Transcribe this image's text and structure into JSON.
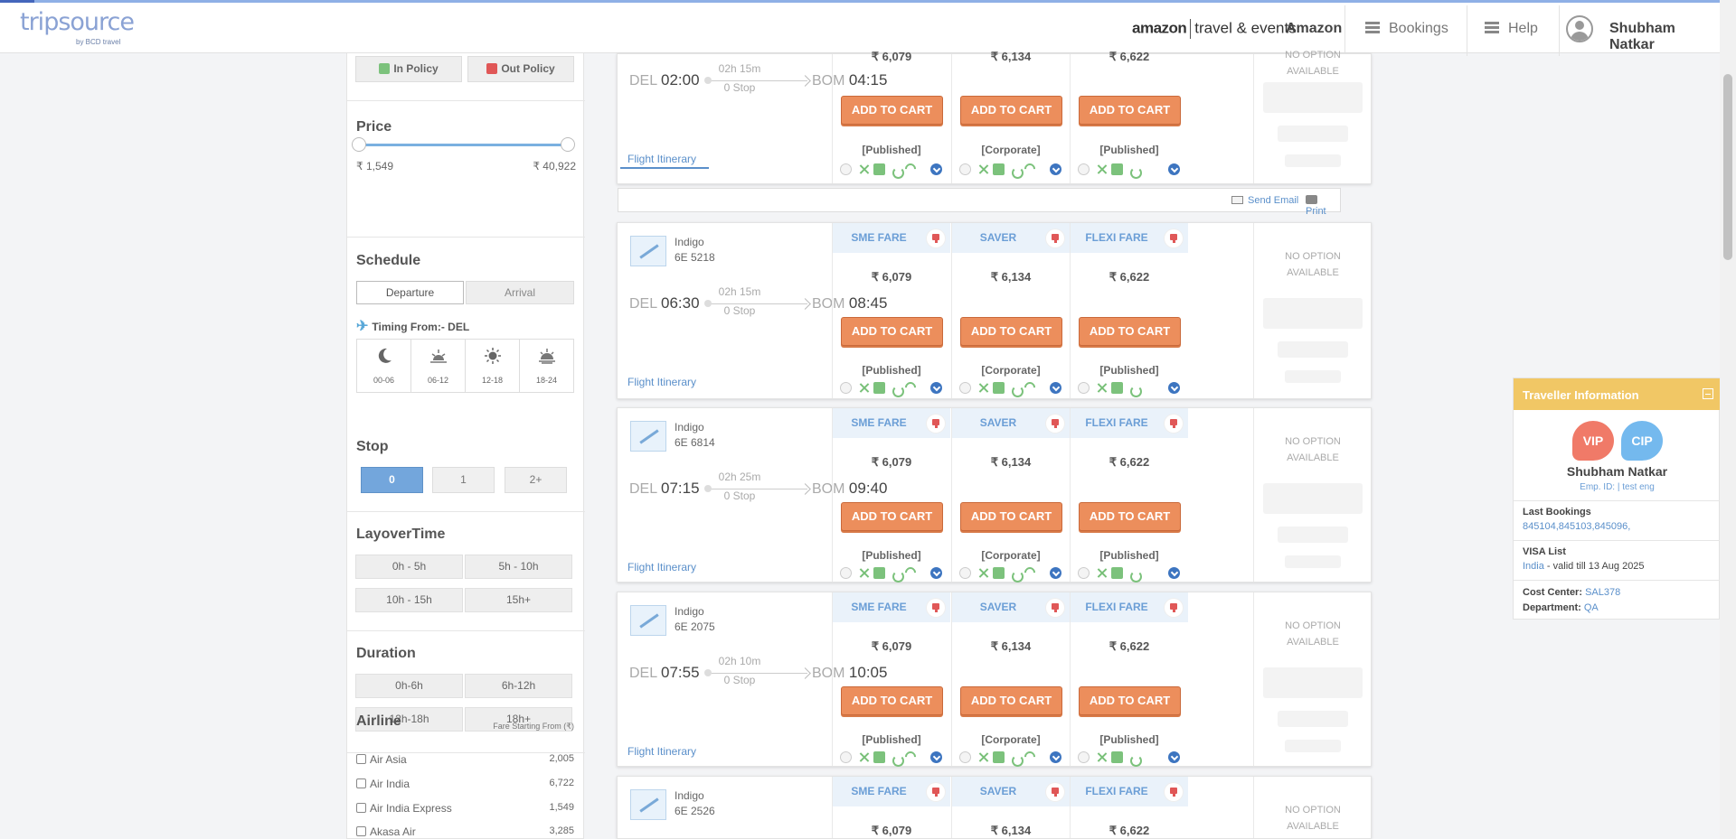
{
  "header": {
    "logo": "tripsource",
    "logo_sub": "by BCD travel",
    "amazon_logo": "amazon",
    "amazon_tag": "travel & events",
    "company": "Amazon",
    "menu": [
      "Bookings",
      "Help"
    ],
    "user": "Shubham Natkar"
  },
  "sidebar": {
    "policy": {
      "in": "In Policy",
      "out": "Out Policy"
    },
    "price": {
      "title": "Price",
      "min": "₹ 1,549",
      "max": "₹ 40,922"
    },
    "schedule": {
      "title": "Schedule",
      "tabs": [
        "Departure",
        "Arrival"
      ],
      "timing": "Timing From:- DEL",
      "slots": [
        {
          "icon": "moon-icon",
          "label": "00-06"
        },
        {
          "icon": "sunrise-icon",
          "label": "06-12"
        },
        {
          "icon": "sun-icon",
          "label": "12-18"
        },
        {
          "icon": "sunset-icon",
          "label": "18-24"
        }
      ]
    },
    "stop": {
      "title": "Stop",
      "options": [
        "0",
        "1",
        "2+"
      ],
      "selected": "0"
    },
    "layover": {
      "title": "LayoverTime",
      "options": [
        "0h - 5h",
        "5h - 10h",
        "10h - 15h",
        "15h+"
      ]
    },
    "duration": {
      "title": "Duration",
      "options": [
        "0h-6h",
        "6h-12h",
        "12h-18h",
        "18h+"
      ]
    },
    "airline": {
      "title": "Airline",
      "fare_label": "Fare Starting From (₹)",
      "items": [
        {
          "name": "Air Asia",
          "price": "2,005"
        },
        {
          "name": "Air India",
          "price": "6,722"
        },
        {
          "name": "Air India Express",
          "price": "1,549"
        },
        {
          "name": "Akasa Air",
          "price": "3,285"
        }
      ]
    }
  },
  "fare_names": [
    "SME FARE",
    "SAVER",
    "FLEXI FARE"
  ],
  "fare_prices": [
    "₹ 6,079",
    "₹ 6,134",
    "₹ 6,622"
  ],
  "fare_types": [
    "[Published]",
    "[Corporate]",
    "[Published]"
  ],
  "cart_label": "ADD TO CART",
  "no_option": [
    "NO OPTION",
    "AVAILABLE"
  ],
  "itinerary_label": "Flight Itinerary",
  "send_email": "Send Email",
  "print": "Print",
  "flights": [
    {
      "airline": "",
      "number": "",
      "from": "DEL",
      "dep": "02:00",
      "to": "BOM",
      "arr": "04:15",
      "duration": "02h 15m",
      "stops": "0 Stop"
    },
    {
      "airline": "Indigo",
      "number": "6E  5218",
      "from": "DEL",
      "dep": "06:30",
      "to": "BOM",
      "arr": "08:45",
      "duration": "02h 15m",
      "stops": "0 Stop"
    },
    {
      "airline": "Indigo",
      "number": "6E  6814",
      "from": "DEL",
      "dep": "07:15",
      "to": "BOM",
      "arr": "09:40",
      "duration": "02h 25m",
      "stops": "0 Stop"
    },
    {
      "airline": "Indigo",
      "number": "6E  2075",
      "from": "DEL",
      "dep": "07:55",
      "to": "BOM",
      "arr": "10:05",
      "duration": "02h 10m",
      "stops": "0 Stop"
    },
    {
      "airline": "Indigo",
      "number": "6E  2526",
      "from": "",
      "dep": "",
      "to": "",
      "arr": "",
      "duration": "",
      "stops": ""
    }
  ],
  "traveller": {
    "title": "Traveller Information",
    "tags": [
      "VIP",
      "CIP"
    ],
    "name": "Shubham Natkar",
    "emp": "Emp. ID: | test eng",
    "last_bookings_label": "Last Bookings",
    "last_bookings": "845104,845103,845096,",
    "visa_label": "VISA List",
    "visa_country": "India",
    "visa_valid": " - valid till 13 Aug 2025",
    "cost_center_label": "Cost Center",
    "cost_center": "SAL378",
    "department_label": "Department",
    "department": "QA"
  },
  "colors": {
    "accent": "#6b9ed6",
    "cart": "#ec8e5c",
    "vip": "#f07a68",
    "cip": "#74b9ee",
    "panel": "#f1c765"
  }
}
